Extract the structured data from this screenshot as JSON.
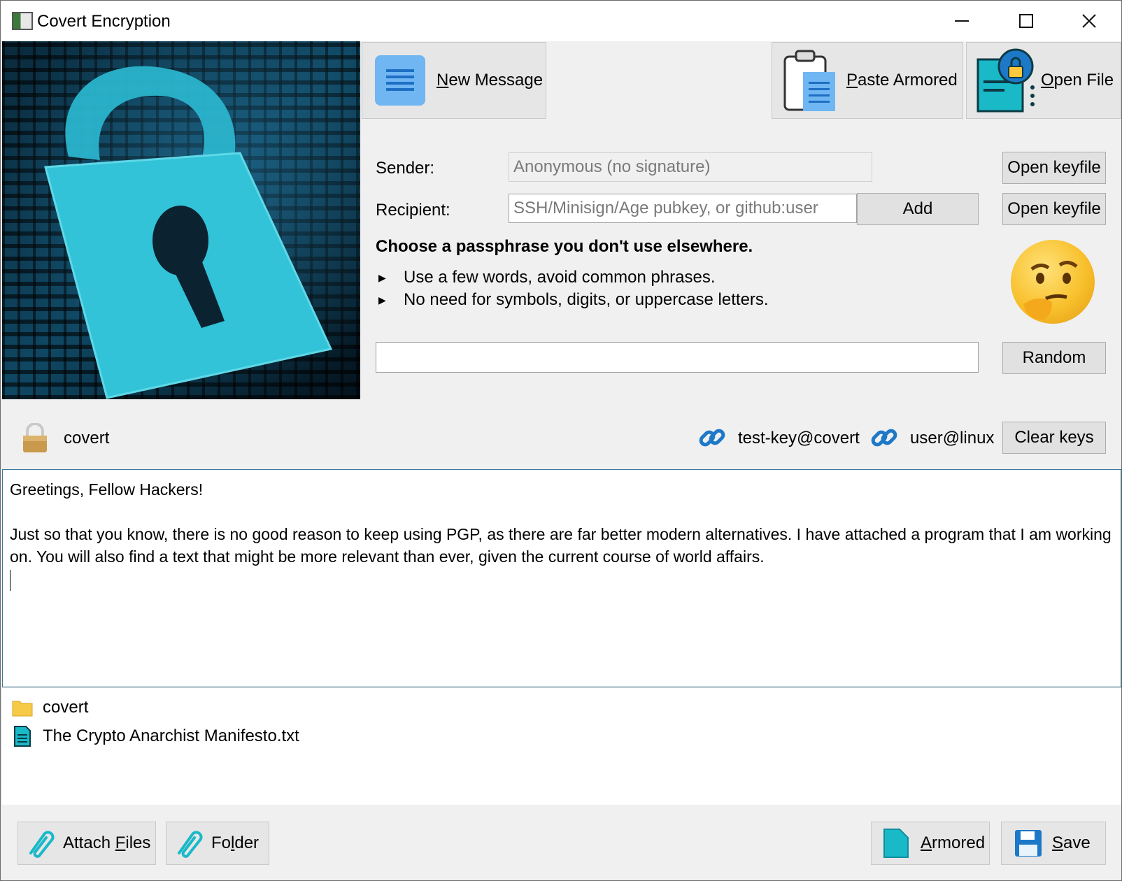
{
  "window": {
    "title": "Covert Encryption",
    "minimize": "—",
    "maximize": "☐",
    "close": "✕"
  },
  "toolbar": {
    "new_message": {
      "accel": "N",
      "rest": "ew Message"
    },
    "paste_armored": {
      "accel": "P",
      "rest": "aste Armored"
    },
    "open_file": {
      "accel": "O",
      "rest": "pen File"
    }
  },
  "form": {
    "sender_label": "Sender:",
    "sender_value": "Anonymous (no signature)",
    "recipient_label": "Recipient:",
    "recipient_placeholder": "SSH/Minisign/Age pubkey, or github:user",
    "add_button": "Add",
    "open_keyfile_1": "Open keyfile",
    "open_keyfile_2": "Open keyfile",
    "passphrase_heading": "Choose a passphrase you don't use elsewhere.",
    "tips": [
      "Use a few words, avoid common phrases.",
      "No need for symbols, digits, or uppercase letters."
    ],
    "passphrase_value": "",
    "random_button": "Random"
  },
  "keys": {
    "own_key": "covert",
    "recipients": [
      "test-key@covert",
      "user@linux"
    ],
    "clear_button": "Clear keys"
  },
  "message": {
    "line1": "Greetings, Fellow Hackers!",
    "line2": "Just so that you know, there is no good reason to keep using PGP, as there are far better modern alternatives. I have attached a program that I am working on. You will also find a text that might be more relevant than ever, given the current course of world affairs."
  },
  "attachments": [
    {
      "name": "covert",
      "icon": "folder-icon"
    },
    {
      "name": "The Crypto Anarchist Manifesto.txt",
      "icon": "text-file-icon"
    }
  ],
  "bottom": {
    "attach_files": {
      "pre": "Attach ",
      "accel": "F",
      "rest": "iles"
    },
    "folder": {
      "pre": "Fo",
      "accel": "l",
      "rest": "der"
    },
    "armored": {
      "accel": "A",
      "rest": "rmored"
    },
    "save": {
      "accel": "S",
      "rest": "ave"
    }
  },
  "colors": {
    "accent": "#3c7a9e",
    "icon_blue": "#1e78c8",
    "icon_teal": "#19b9c8",
    "button_bg": "#e1e1e1"
  }
}
